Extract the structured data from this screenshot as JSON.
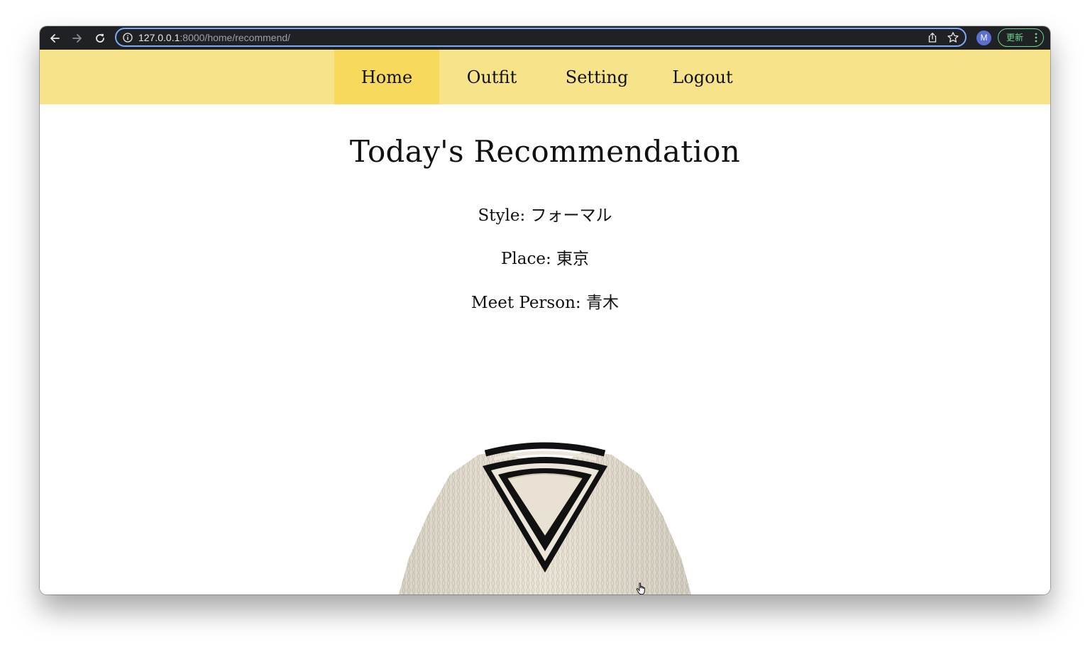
{
  "browser": {
    "url_host": "127.0.0.1",
    "url_path": ":8000/home/recommend/",
    "profile_initial": "M",
    "update_label": "更新"
  },
  "nav": {
    "items": [
      {
        "label": "Home",
        "active": true
      },
      {
        "label": "Outfit",
        "active": false
      },
      {
        "label": "Setting",
        "active": false
      },
      {
        "label": "Logout",
        "active": false
      }
    ]
  },
  "recommendation": {
    "title": "Today's Recommendation",
    "style_line": "Style: フォーマル",
    "place_line": "Place: 東京",
    "person_line": "Meet Person: 青木"
  },
  "colors": {
    "nav_bg": "#f6e38a",
    "nav_active_bg": "#f7da5c",
    "toolbar_bg": "#202124",
    "omnibox_border": "#7cacf8",
    "update_green": "#6dd58c",
    "avatar_bg": "#5a6fd0"
  },
  "icons": [
    "back-arrow-icon",
    "forward-arrow-icon",
    "reload-icon",
    "site-info-icon",
    "share-icon",
    "bookmark-star-icon",
    "more-menu-icon",
    "hand-cursor-icon"
  ]
}
